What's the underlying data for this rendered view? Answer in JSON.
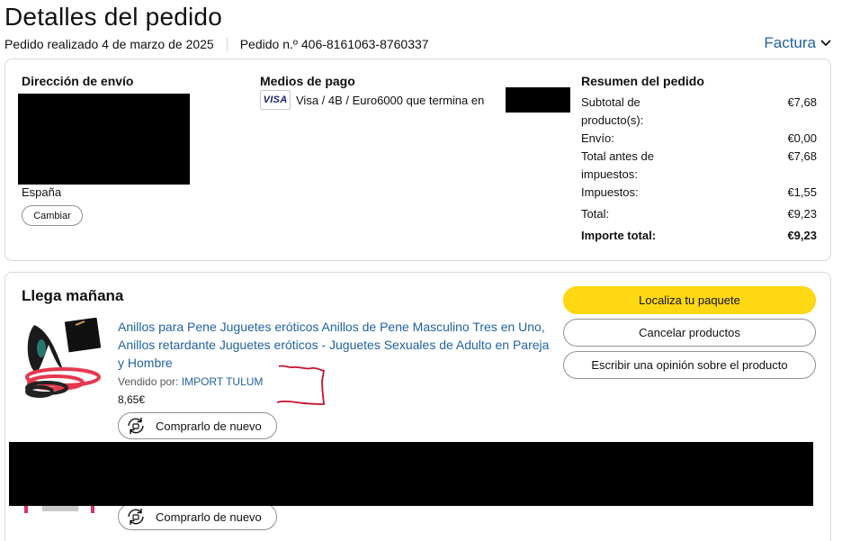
{
  "header": {
    "title": "Detalles del pedido",
    "order_date": "Pedido realizado 4 de marzo de 2025",
    "order_number": "Pedido n.º 406-8161063-8760337",
    "invoice_label": "Factura"
  },
  "shipping": {
    "title": "Dirección de envío",
    "country": "España",
    "change_label": "Cambiar"
  },
  "payment": {
    "title": "Medios de pago",
    "card_brand": "VISA",
    "card_text": "Visa / 4B / Euro6000 que termina en"
  },
  "summary": {
    "title": "Resumen del pedido",
    "rows": [
      {
        "label": "Subtotal de producto(s):",
        "value": "€7,68"
      },
      {
        "label": "Envío:",
        "value": "€0,00"
      },
      {
        "label": "Total antes de impuestos:",
        "value": "€7,68"
      },
      {
        "label": "Impuestos:",
        "value": "€1,55"
      },
      {
        "label": "Total:",
        "value": "€9,23"
      },
      {
        "label": "Importe total:",
        "value": "€9,23"
      }
    ]
  },
  "delivery": {
    "title": "Llega mañana",
    "product": {
      "title": "Anillos para Pene Juguetes eróticos Anillos de Pene Masculino Tres en Uno, Anillos retardante Juguetes eróticos - Juguetes Sexuales de Adulto en Pareja y Hombre",
      "sold_by_label": "Vendido por:",
      "seller": "IMPORT TULUM",
      "price": "8,65€"
    },
    "buy_again_label": "Comprarlo de nuevo",
    "buttons": {
      "track": "Localiza tu paquete",
      "cancel": "Cancelar productos",
      "review": "Escribir una opinión sobre el producto"
    }
  },
  "colors": {
    "link": "#2162a1",
    "track_button": "#ffd814",
    "border": "#d5d9d9"
  }
}
